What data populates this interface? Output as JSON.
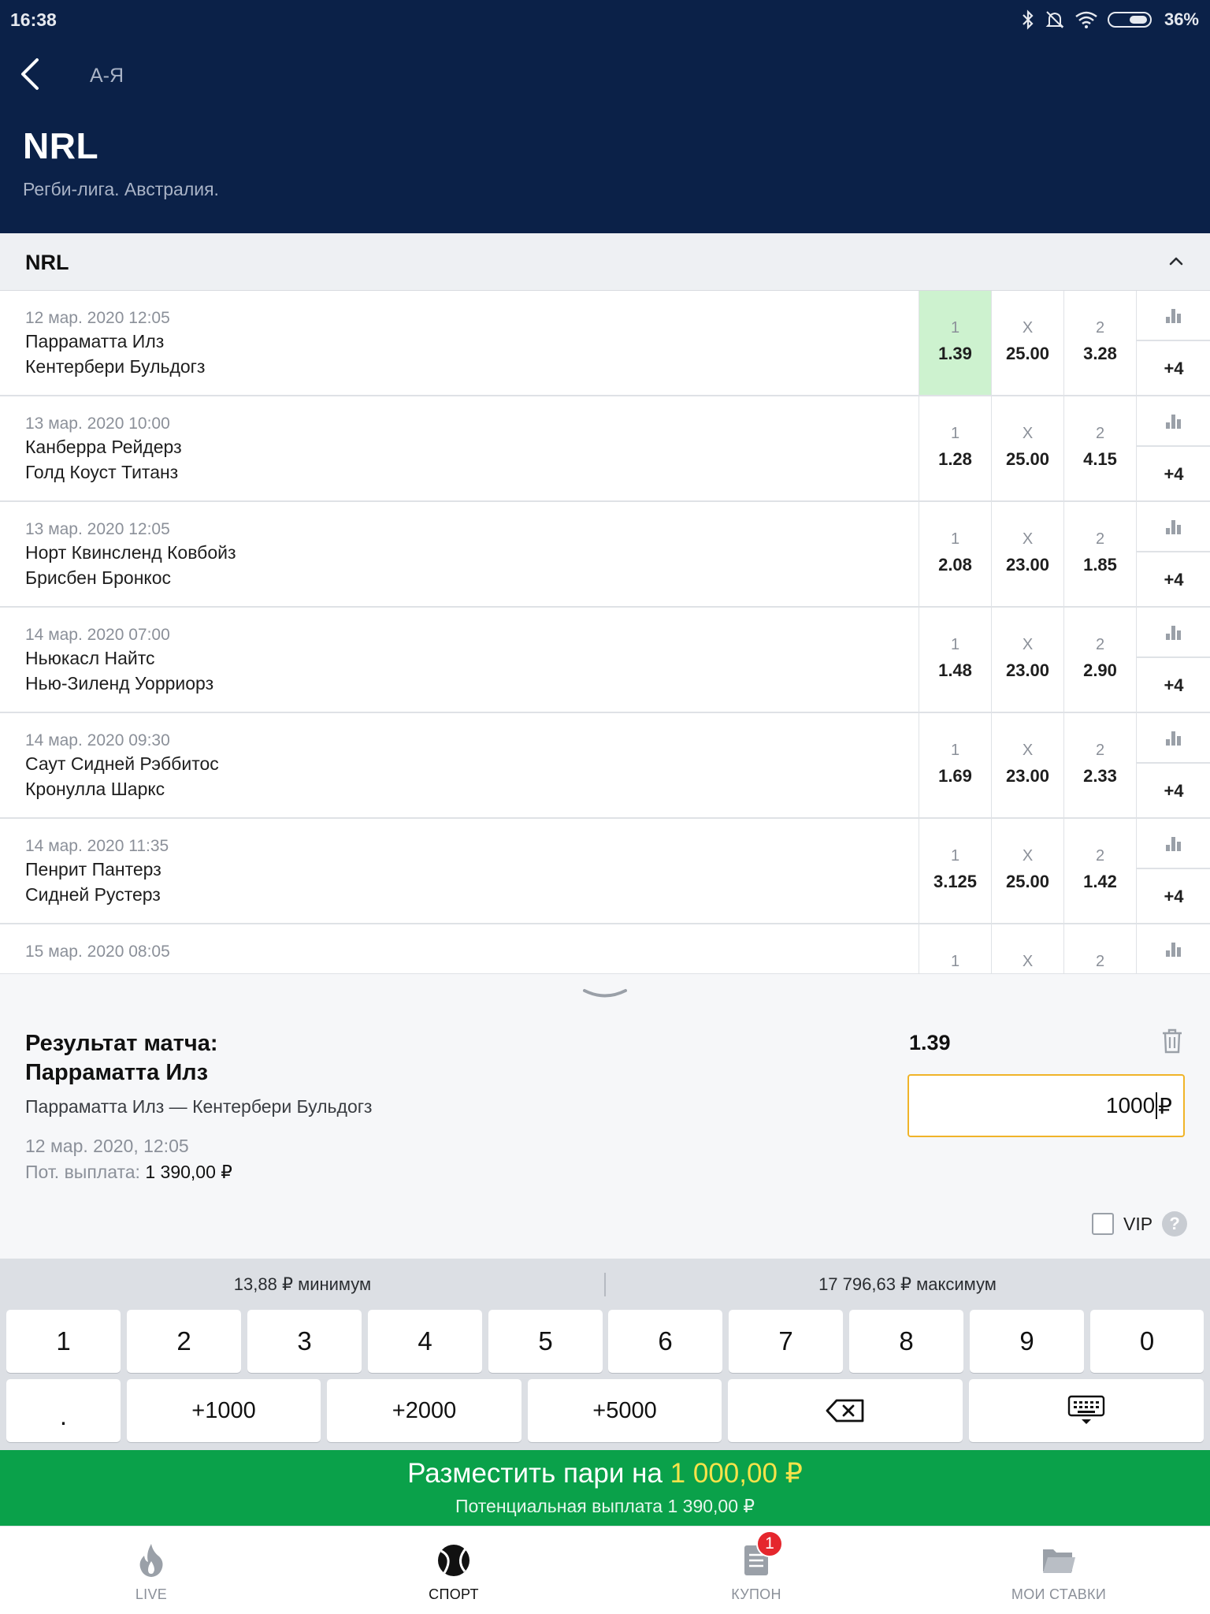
{
  "status_bar": {
    "time": "16:38",
    "battery": "36%"
  },
  "header": {
    "back_label": "А-Я",
    "title": "NRL",
    "subtitle": "Регби-лига. Австралия."
  },
  "section": {
    "title": "NRL"
  },
  "events": [
    {
      "date": "12 мар. 2020 12:05",
      "team1": "Парраматта Илз",
      "team2": "Кентербери Бульдогз",
      "odd1_label": "1",
      "odd1": "1.39",
      "oddx_label": "X",
      "oddx": "25.00",
      "odd2_label": "2",
      "odd2": "3.28",
      "more": "+4"
    },
    {
      "date": "13 мар. 2020 10:00",
      "team1": "Канберра Рейдерз",
      "team2": "Голд Коуст Титанз",
      "odd1_label": "1",
      "odd1": "1.28",
      "oddx_label": "X",
      "oddx": "25.00",
      "odd2_label": "2",
      "odd2": "4.15",
      "more": "+4"
    },
    {
      "date": "13 мар. 2020 12:05",
      "team1": "Норт Квинсленд Ковбойз",
      "team2": "Брисбен Бронкос",
      "odd1_label": "1",
      "odd1": "2.08",
      "oddx_label": "X",
      "oddx": "23.00",
      "odd2_label": "2",
      "odd2": "1.85",
      "more": "+4"
    },
    {
      "date": "14 мар. 2020 07:00",
      "team1": "Ньюкасл Найтс",
      "team2": "Нью-Зиленд Уорриорз",
      "odd1_label": "1",
      "odd1": "1.48",
      "oddx_label": "X",
      "oddx": "23.00",
      "odd2_label": "2",
      "odd2": "2.90",
      "more": "+4"
    },
    {
      "date": "14 мар. 2020 09:30",
      "team1": "Саут Сидней Рэббитос",
      "team2": "Кронулла Шаркс",
      "odd1_label": "1",
      "odd1": "1.69",
      "oddx_label": "X",
      "oddx": "23.00",
      "odd2_label": "2",
      "odd2": "2.33",
      "more": "+4"
    },
    {
      "date": "14 мар. 2020 11:35",
      "team1": "Пенрит Пантерз",
      "team2": "Сидней Рустерз",
      "odd1_label": "1",
      "odd1": "3.125",
      "oddx_label": "X",
      "oddx": "25.00",
      "odd2_label": "2",
      "odd2": "1.42",
      "more": "+4"
    },
    {
      "date": "15 мар. 2020 08:05",
      "team1": "",
      "team2": "",
      "odd1_label": "1",
      "odd1": "",
      "oddx_label": "X",
      "oddx": "",
      "odd2_label": "2",
      "odd2": "",
      "more": ""
    }
  ],
  "slip": {
    "title_line1": "Результат матча:",
    "title_line2": "Парраматта Илз",
    "match": "Парраматта Илз — Кентербери Бульдогз",
    "date": "12 мар. 2020, 12:05",
    "payout_label": "Пот. выплата:",
    "payout_value": "1 390,00 ₽",
    "coefficient": "1.39",
    "stake_value": "1000",
    "currency": "₽",
    "vip_label": "VIP",
    "help": "?"
  },
  "keypad": {
    "min": "13,88 ₽ минимум",
    "max": "17 796,63 ₽ максимум",
    "digits": [
      "1",
      "2",
      "3",
      "4",
      "5",
      "6",
      "7",
      "8",
      "9",
      "0"
    ],
    "dot": ".",
    "quick": [
      "+1000",
      "+2000",
      "+5000"
    ]
  },
  "place_bet": {
    "label": "Разместить пари на",
    "amount": "1 000,00 ₽",
    "sub": "Потенциальная выплата 1 390,00 ₽"
  },
  "nav": {
    "items": [
      "LIVE",
      "СПОРТ",
      "КУПОН",
      "МОИ СТАВКИ"
    ],
    "coupon_badge": "1",
    "active": "СПОРТ"
  },
  "colors": {
    "header_bg": "#0b2148",
    "selected_odd": "#cdf2cf",
    "place_bet_bg": "#0aa14a",
    "place_amount": "#f7e34a",
    "input_border": "#f0b429",
    "badge": "#e5262d"
  }
}
